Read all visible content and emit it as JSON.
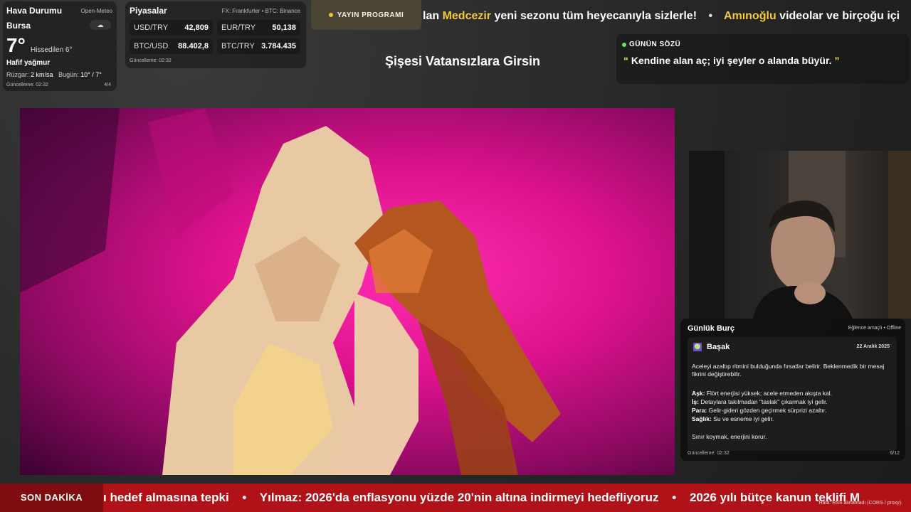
{
  "weather": {
    "title": "Hava Durumu",
    "source": "Open-Meteo",
    "city": "Bursa",
    "icon": "cloud-rain-icon",
    "temp": "7°",
    "feels_like": "Hissedilen 6°",
    "condition": "Hafif yağmur",
    "wind_label": "Rüzgar:",
    "wind_value": "2 km/sa",
    "today_label": "Bugün:",
    "today_value": "10° / 7°",
    "updated": "Güncelleme: 02:32",
    "page": "4/4"
  },
  "markets": {
    "title": "Piyasalar",
    "source": "FX: Frankfurter • BTC: Binance",
    "rows": [
      [
        {
          "label": "USD/TRY",
          "value": "42,809"
        },
        {
          "label": "EUR/TRY",
          "value": "50,138"
        }
      ],
      [
        {
          "label": "BTC/USD",
          "value": "88.402,8"
        },
        {
          "label": "BTC/TRY",
          "value": "3.784.435"
        }
      ]
    ],
    "updated": "Güncelleme: 02:32"
  },
  "schedule_badge": "YAYIN PROGRAMI",
  "top_ticker": {
    "item1_pre": "lan ",
    "item1_highlight": "Medcezir",
    "item1_post": " yeni sezonu tüm heyecanıyla sizlerle!",
    "separator": "•",
    "item2_highlight": "Amınoğlu",
    "item2_post": " videolar ve birçoğu içi"
  },
  "now_playing": "Şişesi Vatansızlara Girsin",
  "quote": {
    "header": "GÜNÜN SÖZÜ",
    "open_mark": "“",
    "text": " Kendine alan aç; iyi şeyler o alanda büyür. ",
    "close_mark": "”"
  },
  "horoscope": {
    "title": "Günlük Burç",
    "mode": "Eğlence amaçlı • Offline",
    "sign_icon": "♍",
    "sign": "Başak",
    "date": "22 Aralık 2025",
    "description": "Aceleyi azaltıp ritmini bulduğunda fırsatlar belirir. Beklenmedik bir mesaj fikrini değiştirebilir.",
    "lines": [
      {
        "label": "Aşk:",
        "text": " Flört enerjisi yüksek; acele etmeden akışta kal."
      },
      {
        "label": "İş:",
        "text": " Detaylara takılmadan \"taslak\" çıkarmak iyi gelir."
      },
      {
        "label": "Para:",
        "text": " Gelir-gideri gözden geçirmek sürprizi azaltır."
      },
      {
        "label": "Sağlık:",
        "text": " Su ve esneme iyi gelir."
      }
    ],
    "footer_note": "Sınır koymak, enerjini korur.",
    "updated": "Güncelleme: 02:32",
    "page": "6/12"
  },
  "breaking": {
    "label": "SON DAKİKA",
    "item1": "ı hedef almasına tepki",
    "separator": "•",
    "item2": "Yılmaz: 2026'da enflasyonu yüzde 20'nin altına indirmeyi hedefliyoruz",
    "item3": "2026 yılı bütçe kanun teklifi M",
    "rss_error": "Hata: RSS alınamadı (CORS / proxy)."
  },
  "colors": {
    "accent": "#f5c842",
    "breaking_bg": "#b01218",
    "breaking_label_bg": "#7e0c10",
    "quote_dot": "#6be06b"
  }
}
